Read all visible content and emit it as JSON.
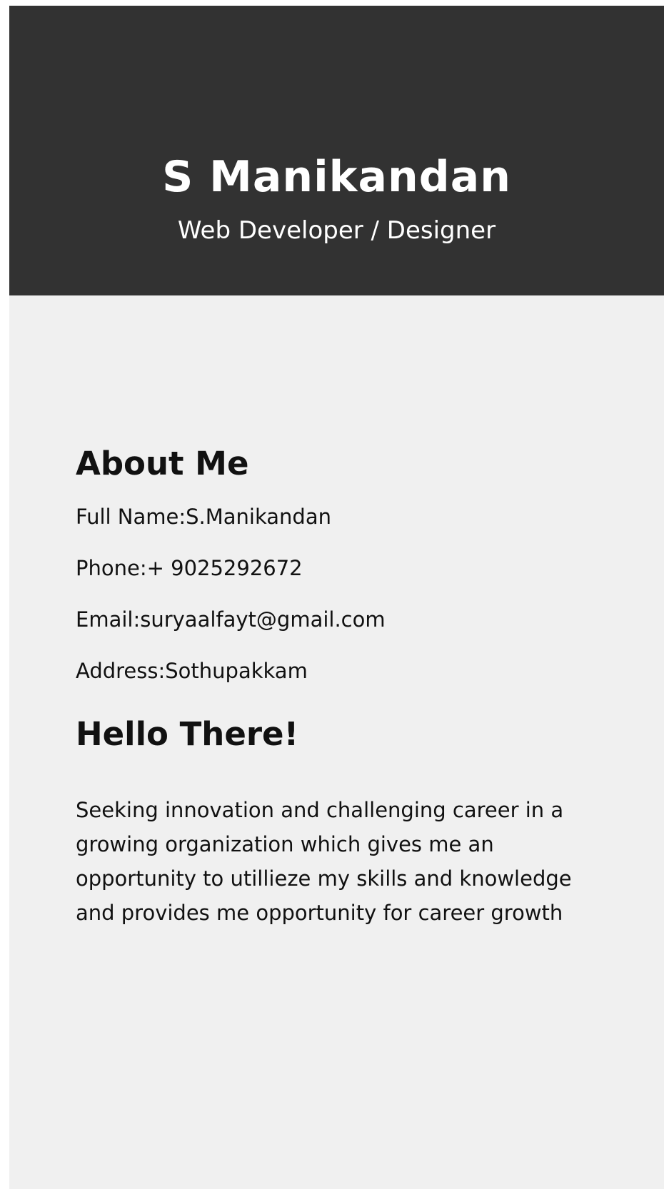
{
  "header": {
    "name": "S Manikandan",
    "role": "Web Developer / Designer"
  },
  "about": {
    "title": "About Me",
    "items": [
      "Full Name:S.Manikandan",
      "Phone:+ 9025292672",
      "Email:suryaalfayt@gmail.com",
      "Address:Sothupakkam"
    ]
  },
  "hello": {
    "title": "Hello There!",
    "text": "Seeking innovation and challenging career in a growing organization which gives me an opportunity to utillieze my skills and knowledge and provides me opportunity for career growth"
  },
  "colors": {
    "header_bg": "#323232",
    "body_bg": "#f0f0f0",
    "text": "#111111"
  }
}
